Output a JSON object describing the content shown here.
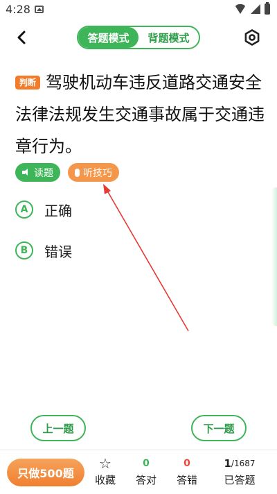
{
  "status": {
    "time": "4:28"
  },
  "header": {
    "mode_active": "答题模式",
    "mode_inactive": "背题模式"
  },
  "question": {
    "type_tag": "判断",
    "text": "驾驶机动车违反道路交通安全法律法规发生交通事故属于交通违章行为。"
  },
  "chips": {
    "read": "读题",
    "tips": "听技巧"
  },
  "options": [
    {
      "letter": "A",
      "text": "正确"
    },
    {
      "letter": "B",
      "text": "错误"
    }
  ],
  "nav": {
    "prev": "上一题",
    "next": "下一题"
  },
  "bottom": {
    "only_button": "只做500题",
    "favorite_label": "收藏",
    "correct_count": "0",
    "correct_label": "答对",
    "wrong_count": "0",
    "wrong_label": "答错",
    "progress_current": "1",
    "progress_total": "/1687",
    "answered_label": "已答题"
  },
  "colors": {
    "accent_green": "#3fb55a",
    "accent_orange": "#f07c2c",
    "wrong_red": "#e84a3c",
    "annotation_red": "#e53935"
  },
  "icons": [
    "back-icon",
    "settings-icon",
    "speaker-icon",
    "mic-icon",
    "star-icon",
    "wifi-icon",
    "signal-icon",
    "battery-icon",
    "image-icon"
  ]
}
